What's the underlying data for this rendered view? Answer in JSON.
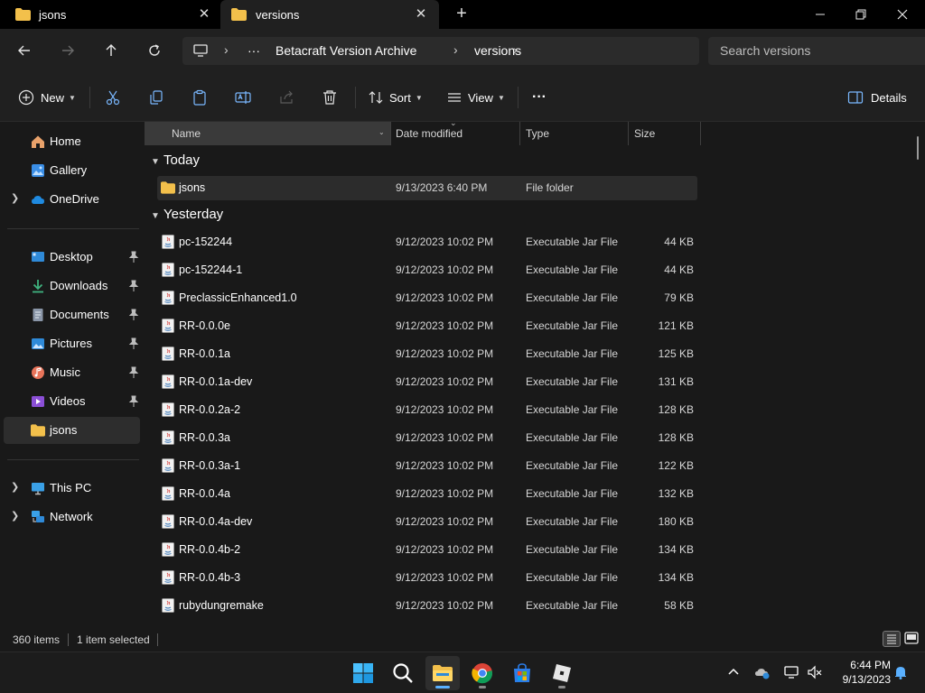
{
  "tabs": [
    {
      "label": "jsons",
      "active": false
    },
    {
      "label": "versions",
      "active": true
    }
  ],
  "navigation": {
    "breadcrumbs": [
      "Betacraft Version Archive",
      "versions"
    ],
    "overflow": "···",
    "search_placeholder": "Search versions"
  },
  "toolbar": {
    "new_label": "New",
    "sort_label": "Sort",
    "view_label": "View",
    "more_label": "···",
    "details_label": "Details"
  },
  "sidebar": {
    "quick": [
      {
        "label": "Home",
        "icon": "home-icon"
      },
      {
        "label": "Gallery",
        "icon": "gallery-icon"
      },
      {
        "label": "OneDrive",
        "icon": "cloud-icon"
      }
    ],
    "pinned": [
      {
        "label": "Desktop",
        "icon": "desktop-icon"
      },
      {
        "label": "Downloads",
        "icon": "download-icon"
      },
      {
        "label": "Documents",
        "icon": "document-icon"
      },
      {
        "label": "Pictures",
        "icon": "pictures-icon"
      },
      {
        "label": "Music",
        "icon": "music-icon"
      },
      {
        "label": "Videos",
        "icon": "videos-icon"
      },
      {
        "label": "jsons",
        "icon": "folder-icon"
      }
    ],
    "devices": [
      {
        "label": "This PC",
        "icon": "pc-icon"
      },
      {
        "label": "Network",
        "icon": "network-icon"
      }
    ]
  },
  "columns": {
    "name": "Name",
    "date": "Date modified",
    "type": "Type",
    "size": "Size"
  },
  "groups": [
    {
      "label": "Today",
      "files": [
        {
          "name": "jsons",
          "date": "9/13/2023 6:40 PM",
          "type": "File folder",
          "size": "",
          "kind": "folder"
        }
      ]
    },
    {
      "label": "Yesterday",
      "files": [
        {
          "name": "pc-152244",
          "date": "9/12/2023 10:02 PM",
          "type": "Executable Jar File",
          "size": "44 KB",
          "kind": "jar"
        },
        {
          "name": "pc-152244-1",
          "date": "9/12/2023 10:02 PM",
          "type": "Executable Jar File",
          "size": "44 KB",
          "kind": "jar"
        },
        {
          "name": "PreclassicEnhanced1.0",
          "date": "9/12/2023 10:02 PM",
          "type": "Executable Jar File",
          "size": "79 KB",
          "kind": "jar"
        },
        {
          "name": "RR-0.0.0e",
          "date": "9/12/2023 10:02 PM",
          "type": "Executable Jar File",
          "size": "121 KB",
          "kind": "jar"
        },
        {
          "name": "RR-0.0.1a",
          "date": "9/12/2023 10:02 PM",
          "type": "Executable Jar File",
          "size": "125 KB",
          "kind": "jar"
        },
        {
          "name": "RR-0.0.1a-dev",
          "date": "9/12/2023 10:02 PM",
          "type": "Executable Jar File",
          "size": "131 KB",
          "kind": "jar"
        },
        {
          "name": "RR-0.0.2a-2",
          "date": "9/12/2023 10:02 PM",
          "type": "Executable Jar File",
          "size": "128 KB",
          "kind": "jar"
        },
        {
          "name": "RR-0.0.3a",
          "date": "9/12/2023 10:02 PM",
          "type": "Executable Jar File",
          "size": "128 KB",
          "kind": "jar"
        },
        {
          "name": "RR-0.0.3a-1",
          "date": "9/12/2023 10:02 PM",
          "type": "Executable Jar File",
          "size": "122 KB",
          "kind": "jar"
        },
        {
          "name": "RR-0.0.4a",
          "date": "9/12/2023 10:02 PM",
          "type": "Executable Jar File",
          "size": "132 KB",
          "kind": "jar"
        },
        {
          "name": "RR-0.0.4a-dev",
          "date": "9/12/2023 10:02 PM",
          "type": "Executable Jar File",
          "size": "180 KB",
          "kind": "jar"
        },
        {
          "name": "RR-0.0.4b-2",
          "date": "9/12/2023 10:02 PM",
          "type": "Executable Jar File",
          "size": "134 KB",
          "kind": "jar"
        },
        {
          "name": "RR-0.0.4b-3",
          "date": "9/12/2023 10:02 PM",
          "type": "Executable Jar File",
          "size": "134 KB",
          "kind": "jar"
        },
        {
          "name": "rubydungremake",
          "date": "9/12/2023 10:02 PM",
          "type": "Executable Jar File",
          "size": "58 KB",
          "kind": "jar"
        }
      ]
    }
  ],
  "status": {
    "item_count": "360 items",
    "selection": "1 item selected"
  },
  "taskbar": {
    "apps": [
      "start-icon",
      "search-icon",
      "file-explorer-icon",
      "chrome-icon",
      "store-icon",
      "roblox-icon"
    ],
    "time": "6:44 PM",
    "date": "9/13/2023"
  },
  "colors": {
    "accent": "#5ab0ff",
    "folder": "#f3c04b",
    "background": "#191919"
  }
}
